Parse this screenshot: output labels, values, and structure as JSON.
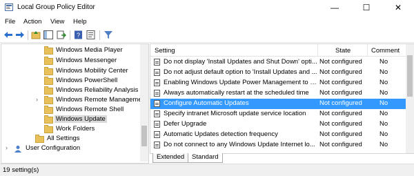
{
  "window": {
    "title": "Local Group Policy Editor",
    "minimize_glyph": "—",
    "maximize_glyph": "☐",
    "close_glyph": "✕"
  },
  "menu": [
    "File",
    "Action",
    "View",
    "Help"
  ],
  "toolbar": {
    "icons": [
      "back-arrow-icon",
      "forward-arrow-icon",
      "up-folder-icon",
      "show-hide-tree-icon",
      "export-list-icon",
      "help-icon",
      "properties-icon",
      "filter-icon"
    ]
  },
  "tree": {
    "items": [
      {
        "label": "Windows Media Player",
        "expander": ""
      },
      {
        "label": "Windows Messenger",
        "expander": ""
      },
      {
        "label": "Windows Mobility Center",
        "expander": ""
      },
      {
        "label": "Windows PowerShell",
        "expander": ""
      },
      {
        "label": "Windows Reliability Analysis",
        "expander": ""
      },
      {
        "label": "Windows Remote Manageme",
        "expander": "›"
      },
      {
        "label": "Windows Remote Shell",
        "expander": ""
      },
      {
        "label": "Windows Update",
        "expander": ""
      },
      {
        "label": "Work Folders",
        "expander": ""
      },
      {
        "label": "All Settings",
        "expander": ""
      },
      {
        "label": "User Configuration",
        "expander": "›"
      }
    ]
  },
  "list": {
    "headers": {
      "setting": "Setting",
      "state": "State",
      "comment": "Comment"
    },
    "rows": [
      {
        "setting": "Do not display 'Install Updates and Shut Down' opti...",
        "state": "Not configured",
        "comment": "No"
      },
      {
        "setting": "Do not adjust default option to 'Install Updates and ...",
        "state": "Not configured",
        "comment": "No"
      },
      {
        "setting": "Enabling Windows Update Power Management to a...",
        "state": "Not configured",
        "comment": "No"
      },
      {
        "setting": "Always automatically restart at the scheduled time",
        "state": "Not configured",
        "comment": "No"
      },
      {
        "setting": "Configure Automatic Updates",
        "state": "Not configured",
        "comment": "No"
      },
      {
        "setting": "Specify intranet Microsoft update service location",
        "state": "Not configured",
        "comment": "No"
      },
      {
        "setting": "Defer Upgrade",
        "state": "Not configured",
        "comment": "No"
      },
      {
        "setting": "Automatic Updates detection frequency",
        "state": "Not configured",
        "comment": "No"
      },
      {
        "setting": "Do not connect to any Windows Update Internet lo...",
        "state": "Not configured",
        "comment": "No"
      }
    ],
    "selected_index": 4
  },
  "tabs": [
    "Extended",
    "Standard"
  ],
  "status": "19 setting(s)",
  "colors": {
    "selection": "#3399ff",
    "folder": "#e8c15a"
  }
}
